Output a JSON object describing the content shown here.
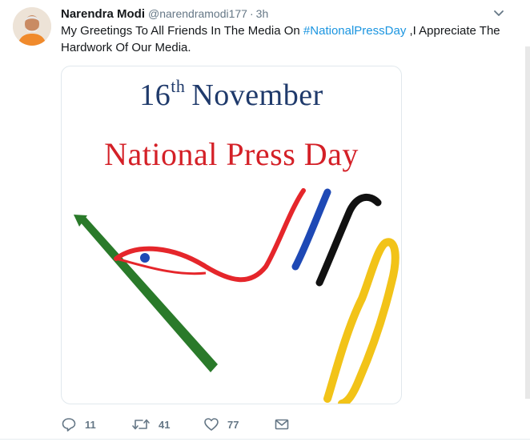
{
  "tweet": {
    "author_name": "Narendra Modi",
    "handle": "@narendramodi177",
    "separator": "·",
    "time": "3h",
    "text_before": "My Greetings To All Friends In The Media On ",
    "hashtag": "#NationalPressDay",
    "text_after": " ,I Appreciate The Hardwork Of Our Media.",
    "avatar_icon": "avatar-photo",
    "caret_icon": "chevron-down-icon"
  },
  "media": {
    "day": "16",
    "ordinal": "th",
    "month": "November",
    "headline": "National Press Day",
    "colors": {
      "date_text": "#1f3a6b",
      "headline_text": "#d42027",
      "green": "#2a7a2a",
      "red": "#e5262b",
      "blue": "#1e49b5",
      "black": "#111111",
      "yellow": "#f2c318"
    }
  },
  "actions": {
    "reply_count": "11",
    "retweet_count": "41",
    "like_count": "77",
    "reply_icon": "reply-icon",
    "retweet_icon": "retweet-icon",
    "like_icon": "heart-icon",
    "dm_icon": "envelope-icon"
  },
  "colors": {
    "accent": "#1b95e0",
    "secondary_text": "#657786"
  }
}
